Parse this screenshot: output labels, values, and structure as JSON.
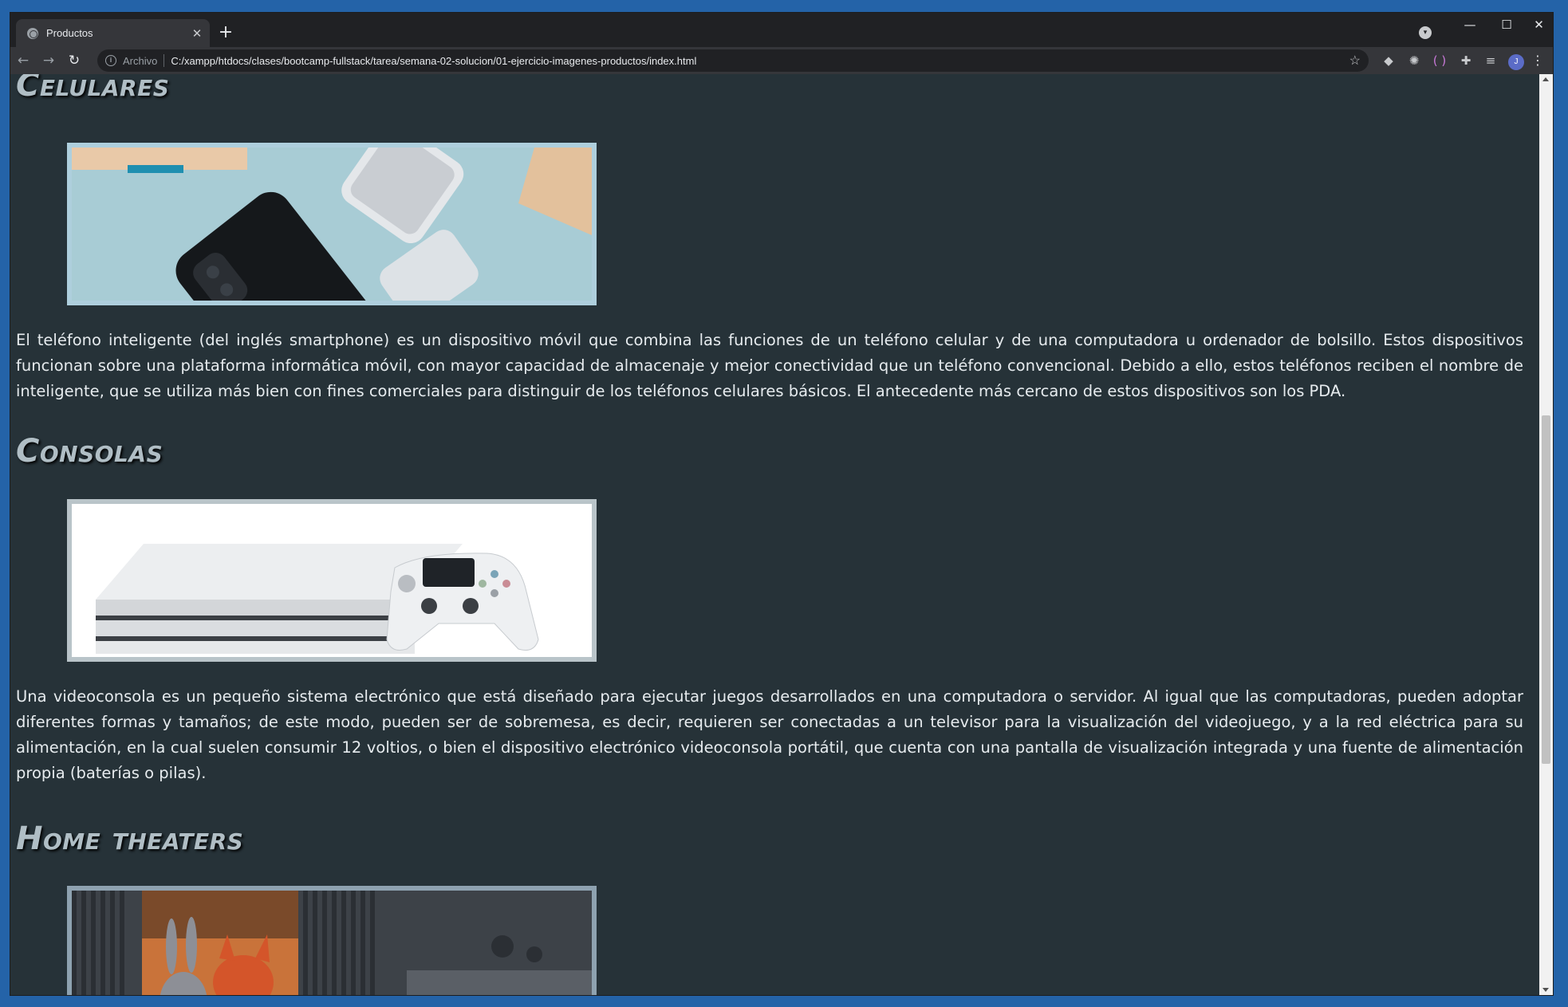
{
  "browser": {
    "tab_title": "Productos",
    "address_scheme": "Archivo",
    "address_url": "C:/xampp/htdocs/clases/bootcamp-fullstack/tarea/semana-02-solucion/01-ejercicio-imagenes-productos/index.html",
    "profile_initial": "J"
  },
  "sections": {
    "celulares": {
      "title": "Celulares",
      "description": "El teléfono inteligente (del inglés smartphone) es un dispositivo móvil que combina las funciones de un teléfono celular y de una computadora u ordenador de bolsillo. Estos dispositivos funcionan sobre una plataforma informática móvil, con mayor capacidad de almacenaje y mejor conectividad que un teléfono convencional. Debido a ello, estos teléfonos reciben el nombre de inteligente, que se utiliza más bien con fines comerciales para distinguir de los teléfonos celulares básicos. El antecedente más cercano de estos dispositivos son los PDA."
    },
    "consolas": {
      "title": "Consolas",
      "description": "Una videoconsola es un pequeño sistema electrónico que está diseñado para ejecutar juegos desarrollados en una computadora o servidor. Al igual que las computadoras, pueden adoptar diferentes formas y tamaños; de este modo, pueden ser de sobremesa, es decir, requieren ser conectadas a un televisor para la visualización del videojuego, y a la red eléctrica para su alimentación, en la cual suelen consumir 12 voltios, o bien el dispositivo electrónico videoconsola portátil, que cuenta con una pantalla de visualización integrada y una fuente de alimentación propia (baterías o pilas)."
    },
    "home_theaters": {
      "title": "Home theaters"
    }
  },
  "icons": {
    "back": "arrow-left-icon",
    "forward": "arrow-right-icon",
    "reload": "reload-icon",
    "bookmark": "star-icon",
    "extensions": "puzzle-icon"
  },
  "colors": {
    "page_background": "#263238",
    "heading": "#b0bec5",
    "text": "#e6ebee"
  }
}
